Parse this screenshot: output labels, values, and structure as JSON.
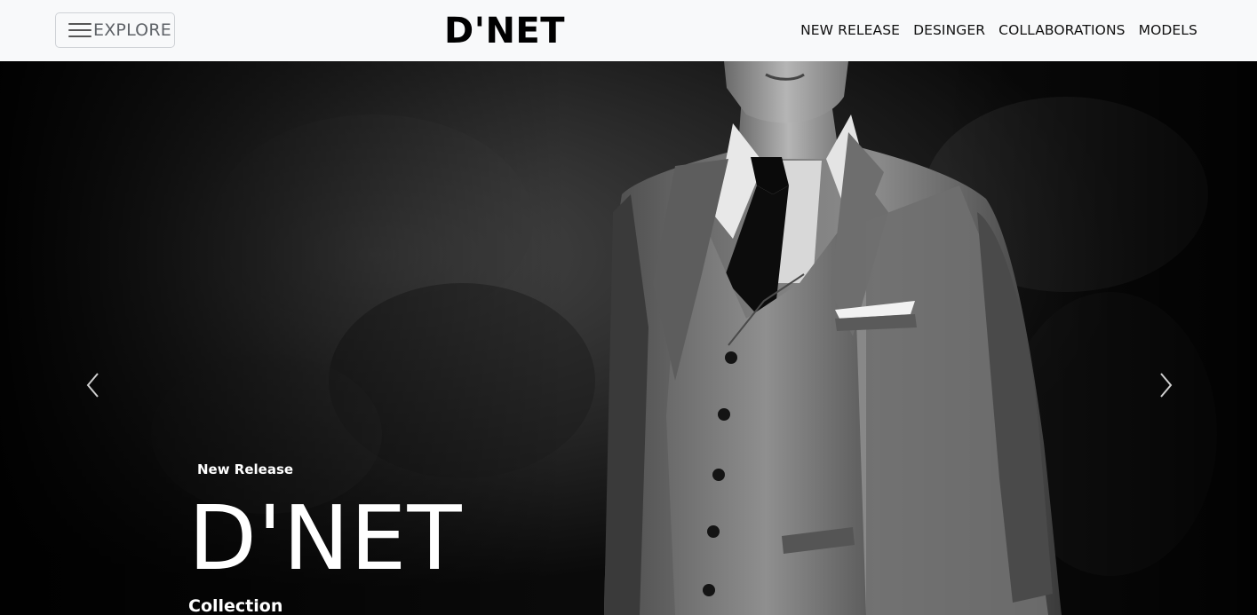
{
  "navbar": {
    "explore_label": "EXPLORE",
    "brand": "D'NET",
    "links": [
      "NEW RELEASE",
      "DESINGER",
      "COLLABORATIONS",
      "MODELS"
    ]
  },
  "hero": {
    "eyebrow": "New Release",
    "title": "D'NET",
    "subtitle": "Collection",
    "image": "black-and-white portrait of a man in a grey three-piece suit with black tie and pocket square",
    "prev_icon": "chevron-left-icon",
    "next_icon": "chevron-right-icon"
  },
  "colors": {
    "navbar_bg": "#f8f9fa",
    "hero_text": "#ffffff",
    "brand_text": "#000000"
  }
}
